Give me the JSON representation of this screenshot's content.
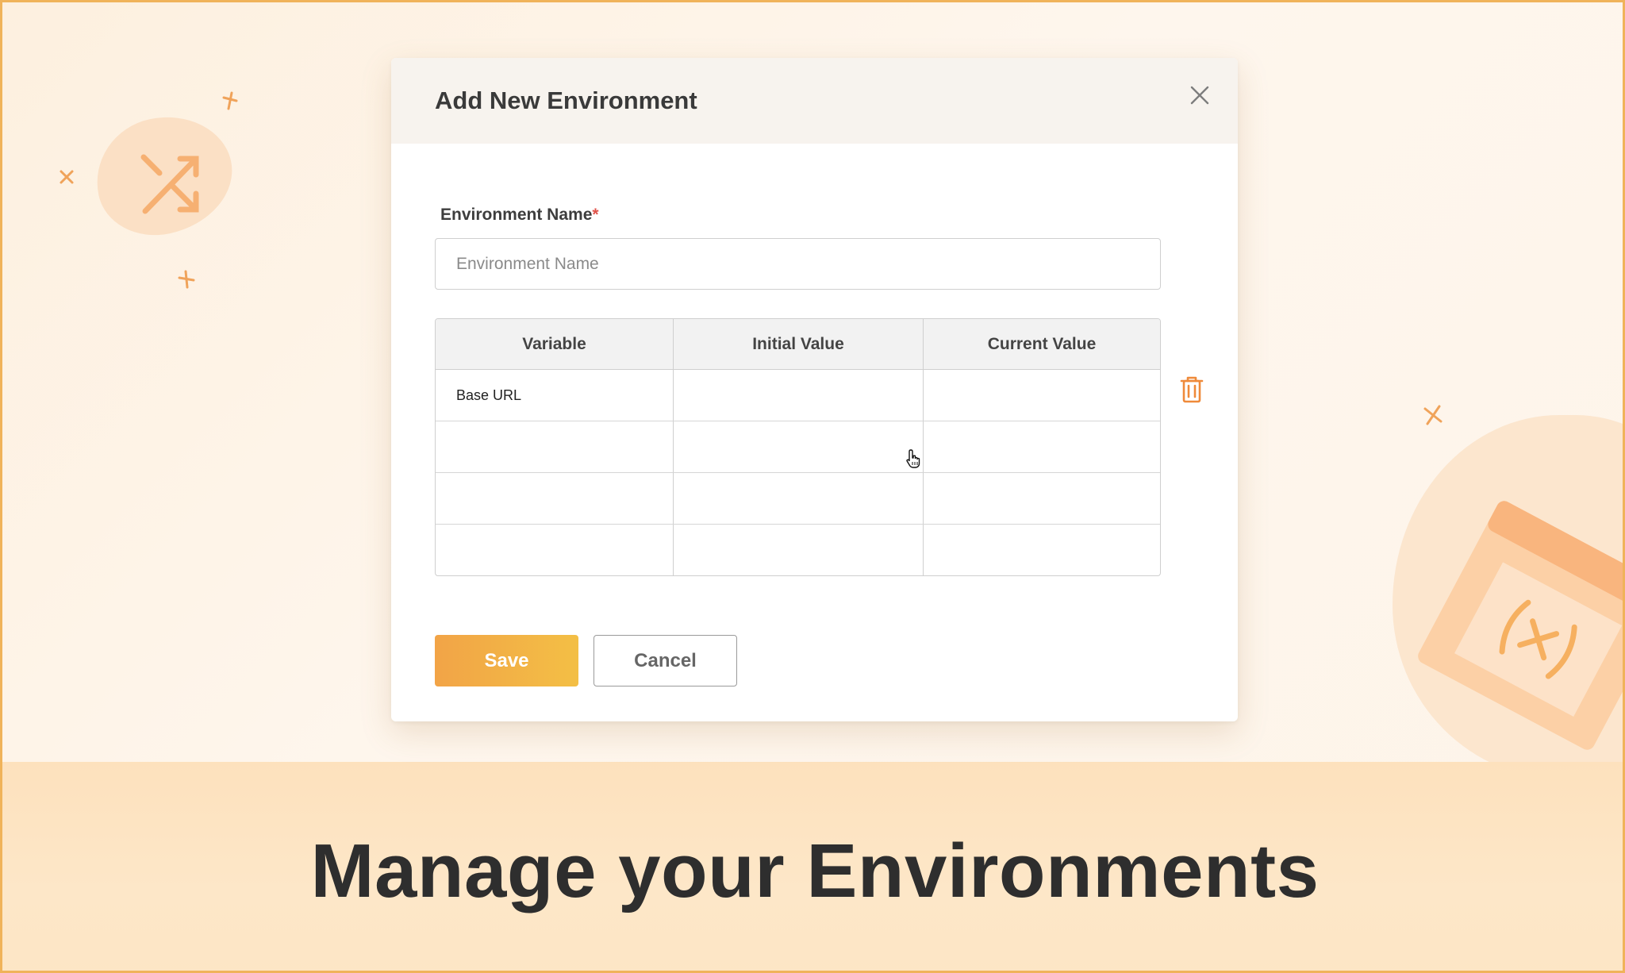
{
  "modal": {
    "title": "Add New Environment",
    "field_label": "Environment Name",
    "required_marker": "*",
    "name_placeholder": "Environment Name",
    "name_value": ""
  },
  "table": {
    "headers": [
      "Variable",
      "Initial Value",
      "Current Value"
    ],
    "rows": [
      [
        "Base URL",
        "",
        ""
      ],
      [
        "",
        "",
        ""
      ],
      [
        "",
        "",
        ""
      ],
      [
        "",
        "",
        ""
      ]
    ]
  },
  "buttons": {
    "save_label": "Save",
    "cancel_label": "Cancel"
  },
  "banner": {
    "tagline": "Manage your Environments"
  },
  "icons": {
    "close": "close-icon",
    "delete": "trash-icon",
    "shuffle": "shuffle-icon",
    "variable": "variable-icon",
    "cursor": "hand-pointer-icon"
  },
  "colors": {
    "accent": "#f2a447",
    "accent_end": "#f3bf45",
    "border": "#f0b35a",
    "required": "#e0524a",
    "trash": "#ef8a3a"
  }
}
